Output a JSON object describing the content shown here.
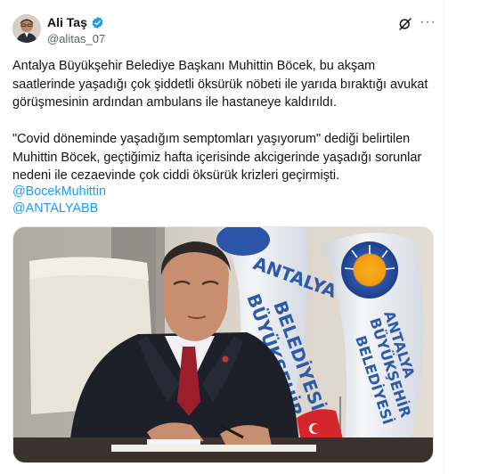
{
  "tweet": {
    "author_name": "Ali Taş",
    "handle": "@alitas_07",
    "paragraph_1": "Antalya Büyükşehir Belediye Başkanı Muhittin Böcek, bu akşam saatlerinde yaşadığı çok şiddetli öksürük nöbeti ile yarıda bıraktığı avukat görüşmesinin ardından ambulans ile hastaneye kaldırıldı.",
    "paragraph_2": "\"Covid döneminde yaşadığım semptomları yaşıyorum\" dediği belirtilen Muhittin Böcek, geçtiğimiz hafta içerisinde akcigerinde yaşadığı sorunlar nedeni ile cezaevinde çok ciddi öksürük krizleri geçirmişti.",
    "mentions": [
      "@BocekMuhittin",
      "@ANTALYABB"
    ],
    "more_label": "···"
  },
  "media": {
    "flag_text_1": "ANTALYA",
    "flag_text_2": "BÜYÜKŞEHİR",
    "flag_text_3": "BELEDİYESİ",
    "flag_right_1": "ANTALYA",
    "flag_right_2": "BÜYÜKŞEHİR",
    "flag_right_3": "BELEDİYESİ"
  },
  "colors": {
    "link": "#1d9bf0",
    "verified": "#1d9bf0",
    "secondary_text": "#536471"
  },
  "icons": {
    "verified": "verified-badge-icon",
    "grok": "grok-icon",
    "more": "more-icon"
  }
}
